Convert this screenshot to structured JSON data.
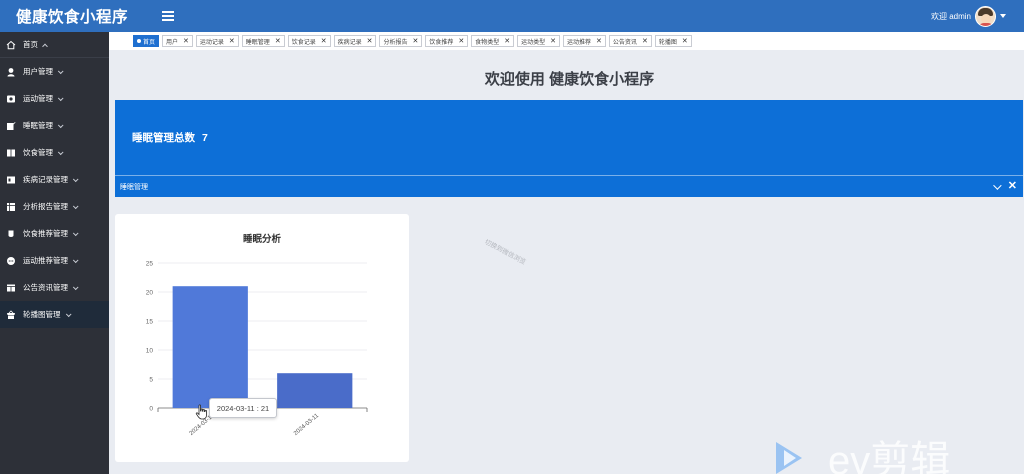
{
  "app": {
    "title": "健康饮食小程序",
    "welcome": "欢迎 admin"
  },
  "sidebar": {
    "items": [
      {
        "label": "首页",
        "icon": "home-icon"
      },
      {
        "label": "用户管理",
        "icon": "user-icon"
      },
      {
        "label": "运动管理",
        "icon": "run-icon"
      },
      {
        "label": "睡眠管理",
        "icon": "edit-icon"
      },
      {
        "label": "饮食管理",
        "icon": "book-icon"
      },
      {
        "label": "疾病记录管理",
        "icon": "record-icon"
      },
      {
        "label": "分析报告管理",
        "icon": "report-icon"
      },
      {
        "label": "饮食推荐管理",
        "icon": "cup-icon"
      },
      {
        "label": "运动推荐管理",
        "icon": "chat-icon"
      },
      {
        "label": "公告资讯管理",
        "icon": "news-icon"
      },
      {
        "label": "轮播图管理",
        "icon": "shop-icon"
      }
    ]
  },
  "tabs": [
    {
      "label": "首页",
      "active": true
    },
    {
      "label": "用户",
      "active": false
    },
    {
      "label": "运动记录",
      "active": false
    },
    {
      "label": "睡眠管理",
      "active": false
    },
    {
      "label": "饮食记录",
      "active": false
    },
    {
      "label": "疾病记录",
      "active": false
    },
    {
      "label": "分析报告",
      "active": false
    },
    {
      "label": "饮食推荐",
      "active": false
    },
    {
      "label": "食物类型",
      "active": false
    },
    {
      "label": "运动类型",
      "active": false
    },
    {
      "label": "运动推荐",
      "active": false
    },
    {
      "label": "公告资讯",
      "active": false
    },
    {
      "label": "轮播图",
      "active": false
    }
  ],
  "main": {
    "page_title": "欢迎使用 健康饮食小程序",
    "stat_card": {
      "label": "睡眠管理总数",
      "value": "7",
      "footer_label": "睡眠管理",
      "color": "#0d6fd7"
    },
    "watermark": "切换到微信浏览"
  },
  "tooltip": "2024-03-11 : 21",
  "colors": {
    "topbar": "#2f6fbe",
    "sidebar": "#2d3038",
    "accent": "#1e6fd0",
    "bar_primary": "#5079d9",
    "bar_secondary": "#4a6cc9"
  },
  "chart_data": {
    "type": "bar",
    "title": "睡眠分析",
    "categories": [
      "2024-03-11",
      "2024-03-11"
    ],
    "values": [
      21,
      6
    ],
    "ylim": [
      0,
      25
    ],
    "yticks": [
      0,
      5,
      10,
      15,
      20,
      25
    ],
    "xlabel": "",
    "ylabel": "",
    "grid": true
  },
  "ev_logo_text": "ev剪辑"
}
